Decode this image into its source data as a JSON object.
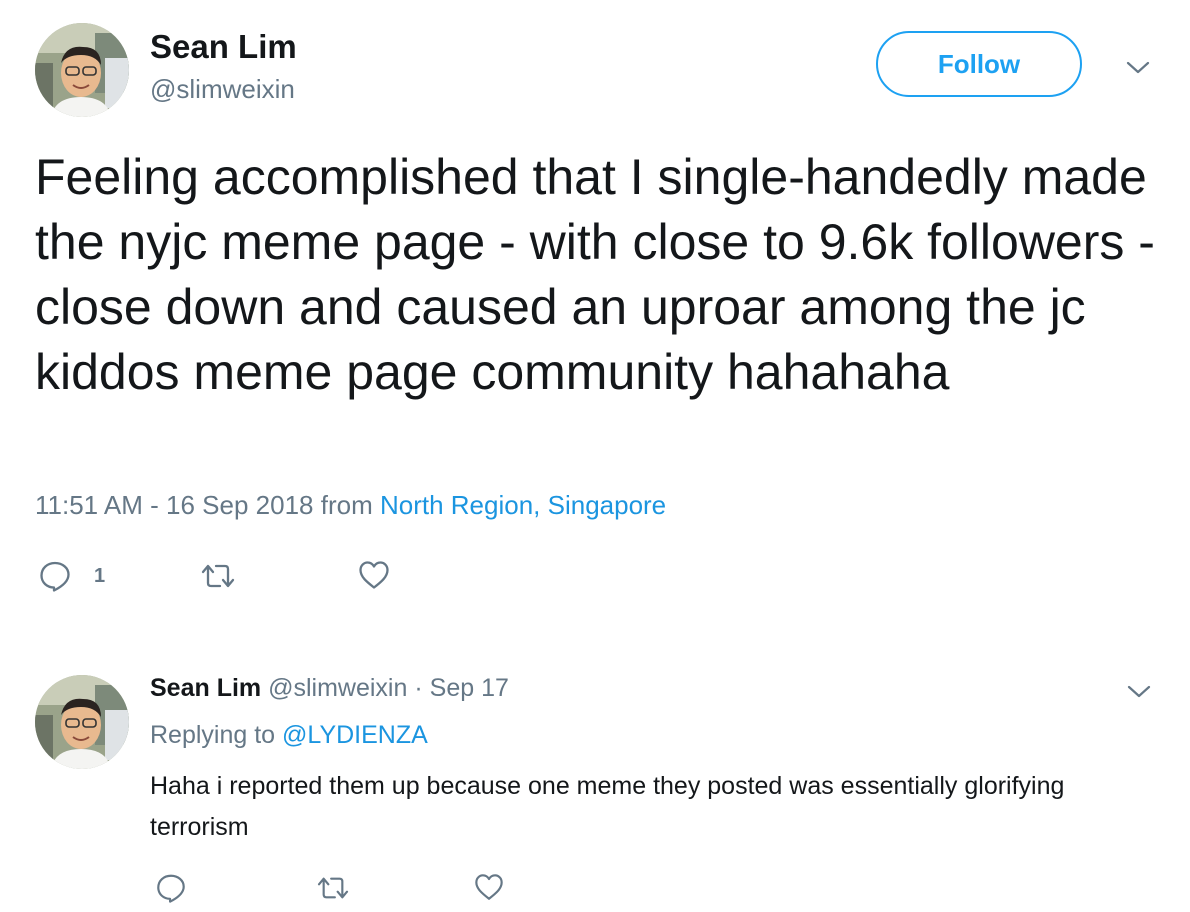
{
  "main_tweet": {
    "author_name": "Sean Lim",
    "author_handle": "@slimweixin",
    "follow_label": "Follow",
    "text": "Feeling accomplished that I single-handedly made the nyjc meme page - with close to 9.6k followers - close down and caused an uproar among the jc kiddos meme page community hahahaha",
    "timestamp": "11:51 AM - 16 Sep 2018",
    "from_word": "from",
    "location": "North Region, Singapore",
    "reply_count": "1",
    "icons": {
      "reply": "reply-bubble-icon",
      "retweet": "retweet-icon",
      "like": "heart-icon",
      "more": "chevron-down-icon"
    }
  },
  "reply_tweet": {
    "author_name": "Sean Lim",
    "author_handle": "@slimweixin",
    "separator": "·",
    "date": "Sep 17",
    "replying_label": "Replying to",
    "replying_to": "@LYDIENZA",
    "text": "Haha i reported them up because one meme they posted was essentially glorifying terrorism"
  },
  "colors": {
    "accent": "#1da1f2",
    "link": "#1b95e0",
    "text_primary": "#14171a",
    "text_secondary": "#657786"
  }
}
